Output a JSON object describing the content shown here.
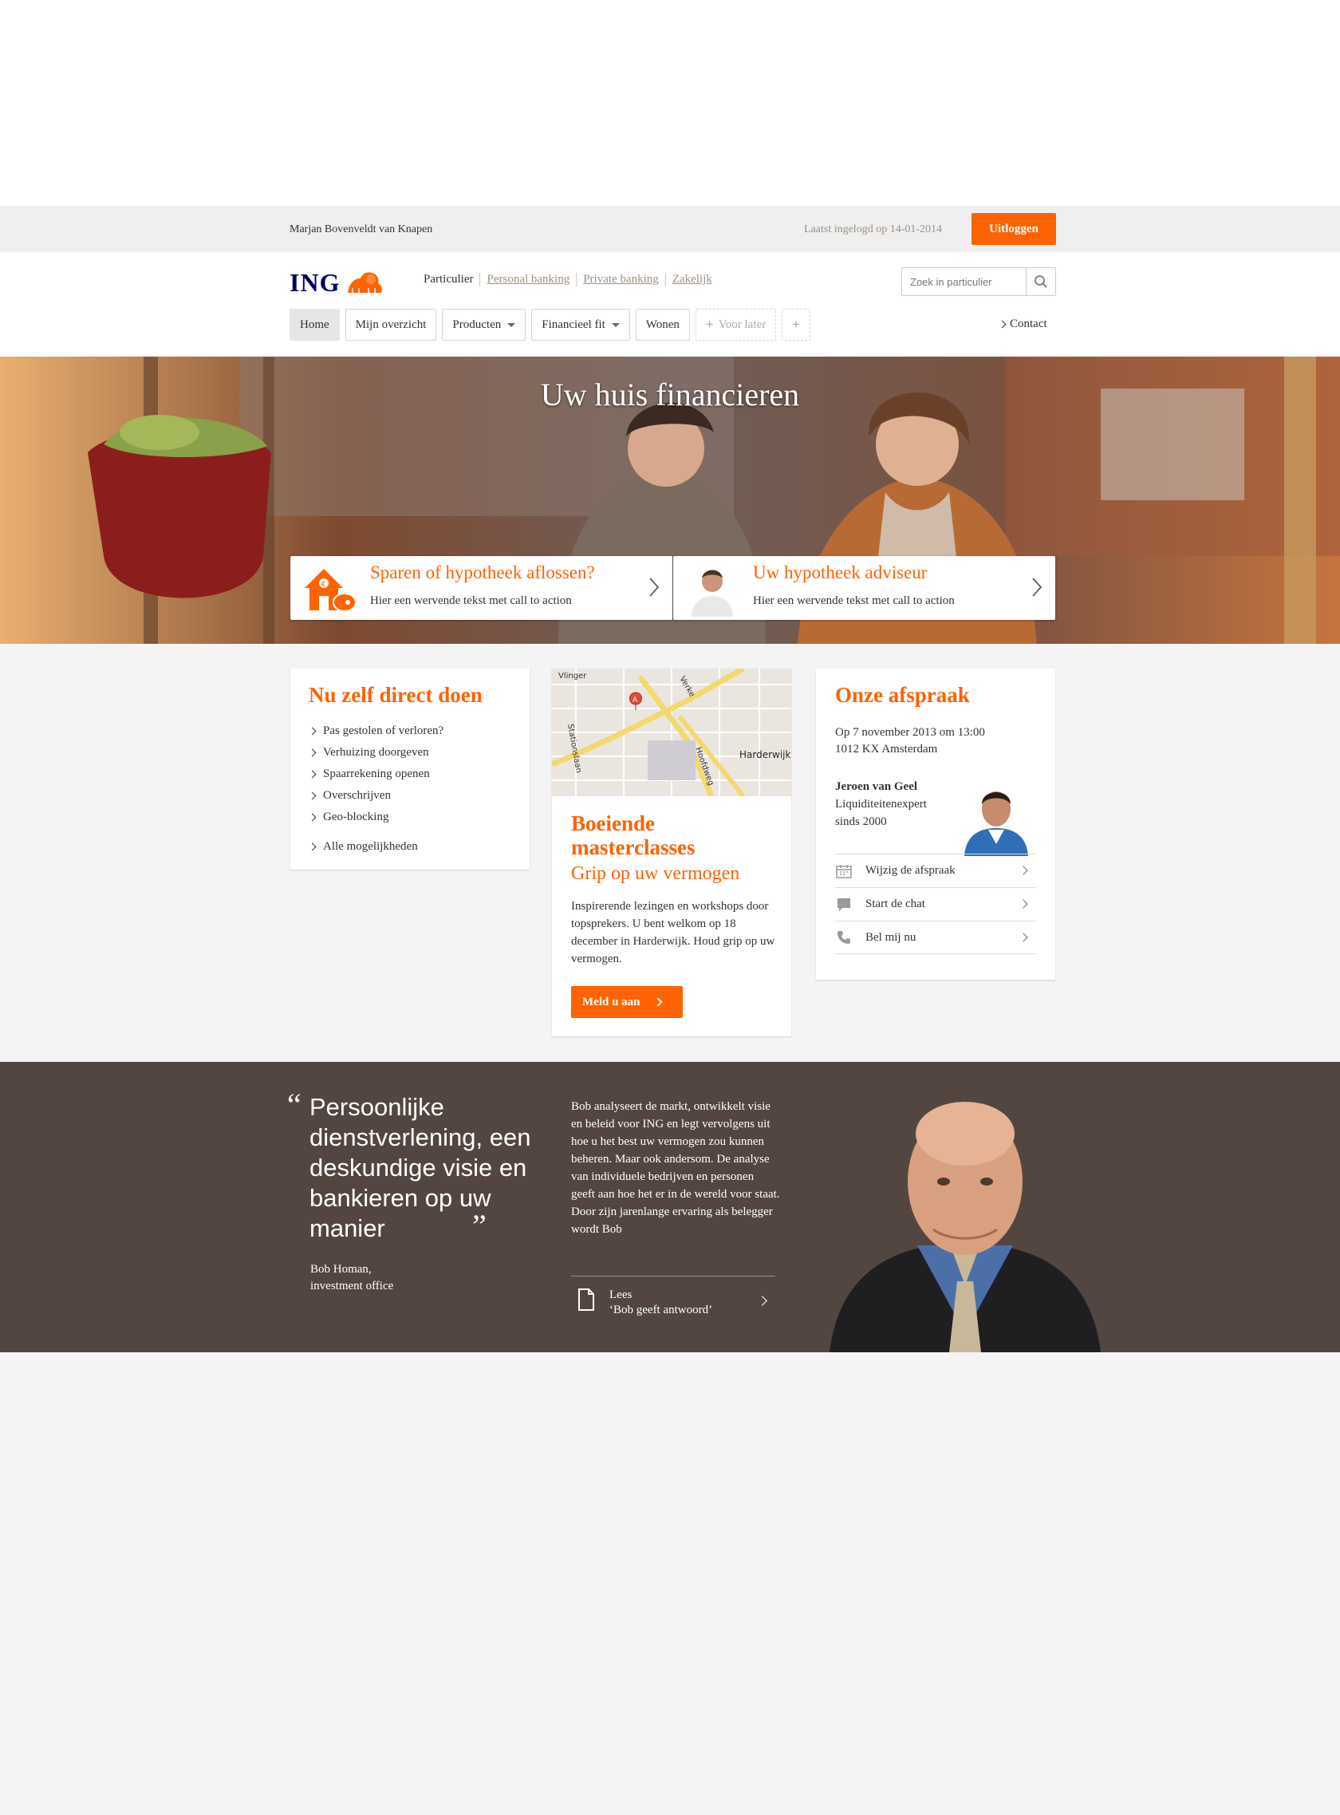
{
  "userbar": {
    "username": "Marjan Bovenveldt van Knapen",
    "last_login": "Laatst ingelogd op 14-01-2014",
    "logout_label": "Uitloggen"
  },
  "header": {
    "logo_text": "ING",
    "segments": [
      {
        "label": "Particulier"
      },
      {
        "label": "Personal banking"
      },
      {
        "label": "Private banking"
      },
      {
        "label": "Zakelijk"
      }
    ],
    "search_placeholder": "Zoek in particulier",
    "nav": [
      {
        "label": "Home"
      },
      {
        "label": "Mijn overzicht"
      },
      {
        "label": "Producten"
      },
      {
        "label": "Financieel fit"
      },
      {
        "label": "Wonen"
      },
      {
        "label": "Voor later"
      },
      {
        "label": "+"
      }
    ],
    "contact_label": "Contact"
  },
  "hero": {
    "title": "Uw huis financieren",
    "cta_left": {
      "title": "Sparen of hypotheek aflossen?",
      "desc": "Hier een wervende tekst met call to action"
    },
    "cta_right": {
      "title": "Uw hypotheek adviseur",
      "desc": "Hier een wervende tekst met call to action"
    }
  },
  "direct": {
    "title": "Nu zelf direct doen",
    "items": [
      "Pas gestolen of verloren?",
      "Verhuizing doorgeven",
      "Spaarrekening openen",
      "Overschrijven",
      "Geo-blocking"
    ],
    "all_label": "Alle mogelijkheden"
  },
  "masterclass": {
    "map_labels": {
      "a": "Vlinger",
      "b": "Stationslaan",
      "c": "Verke",
      "d": "Hoofdweg",
      "e": "Harderwijk"
    },
    "title_line1": "Boeiende",
    "title_line2": "masterclasses",
    "subtitle": "Grip op uw vermogen",
    "text": "Inspirerende lezingen en workshops door topsprekers. U bent welkom op 18 december in Harderwijk. Houd grip op uw vermogen.",
    "button_label": "Meld u aan"
  },
  "afspraak": {
    "title": "Onze afspraak",
    "date": "Op 7 november 2013 om 13:00",
    "address": "1012 KX Amsterdam",
    "advisor_name": "Jeroen van Geel",
    "advisor_role": "Liquiditeitenexpert",
    "advisor_since": "sinds 2000",
    "actions": [
      {
        "label": "Wijzig de afspraak",
        "icon": "calendar-icon"
      },
      {
        "label": "Start de chat",
        "icon": "chat-icon"
      },
      {
        "label": "Bel mij nu",
        "icon": "phone-icon"
      }
    ]
  },
  "quote": {
    "text": "Persoonlijke dienstverlening, een deskundige visie en bankieren op uw manier",
    "author_name": "Bob Homan,",
    "author_role": "investment office",
    "body": "Bob analyseert de markt, ontwikkelt visie en beleid voor ING en legt vervolgens uit hoe u het best uw vermogen zou kunnen beheren. Maar ook andersom. De analyse van individuele bedrijven en personen geeft aan hoe het er in de wereld voor staat. Door zijn jarenlange ervaring als belegger wordt Bob",
    "read_label_1": "Lees",
    "read_label_2": "‘Bob geeft antwoord’"
  },
  "colors": {
    "accent": "#ff6200",
    "brand_blue": "#000066",
    "band": "#534641",
    "muted": "#a08f80"
  }
}
